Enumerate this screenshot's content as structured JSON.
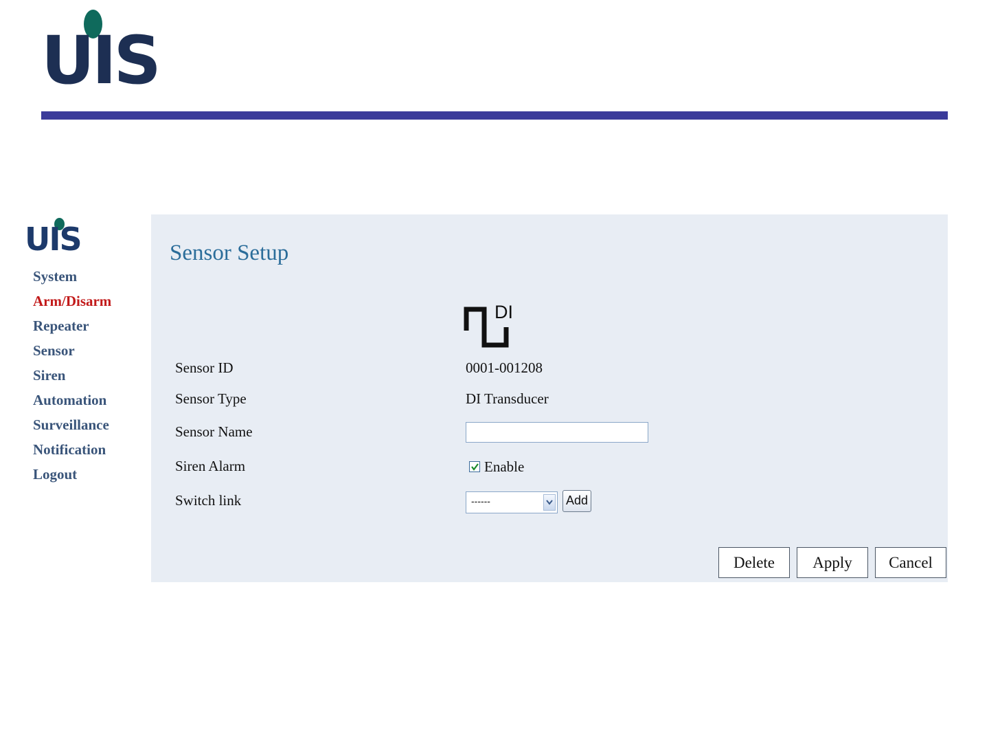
{
  "header": {
    "logo_text": "UIS",
    "bar_color": "#3b3b9a"
  },
  "sidebar": {
    "logo_text": "UIS",
    "items": [
      {
        "label": "System"
      },
      {
        "label": "Arm/Disarm",
        "active": true
      },
      {
        "label": "Repeater"
      },
      {
        "label": "Sensor"
      },
      {
        "label": "Siren"
      },
      {
        "label": "Automation"
      },
      {
        "label": "Surveillance"
      },
      {
        "label": "Notification"
      },
      {
        "label": "Logout"
      }
    ]
  },
  "main": {
    "title": "Sensor Setup",
    "icon": {
      "name": "di-transducer-icon",
      "label": "DI"
    },
    "fields": {
      "sensor_id": {
        "label": "Sensor ID",
        "value": "0001-001208"
      },
      "sensor_type": {
        "label": "Sensor Type",
        "value": "DI Transducer"
      },
      "sensor_name": {
        "label": "Sensor Name",
        "value": "",
        "placeholder": ""
      },
      "siren_alarm": {
        "label": "Siren Alarm",
        "checkbox_label": "Enable",
        "checked": true
      },
      "switch_link": {
        "label": "Switch link",
        "selected": "------",
        "add_label": "Add"
      }
    },
    "actions": {
      "delete": "Delete",
      "apply": "Apply",
      "cancel": "Cancel"
    }
  },
  "colors": {
    "panel_bg": "#e8edf4",
    "title": "#2b6d9a",
    "nav_text": "#3a557a",
    "nav_active": "#c21a1a"
  }
}
